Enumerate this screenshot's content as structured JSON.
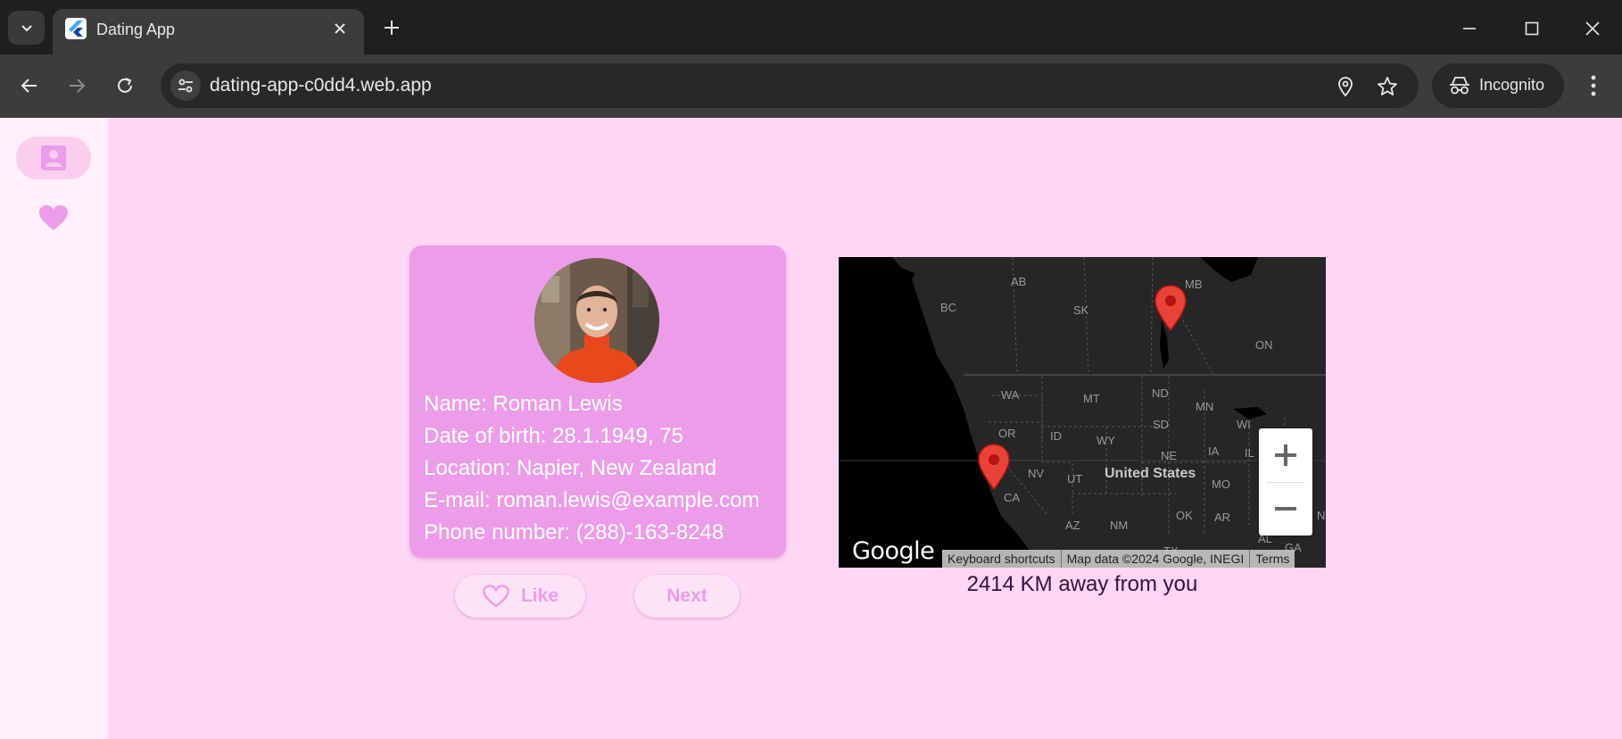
{
  "browser": {
    "tab_title": "Dating App",
    "url": "dating-app-c0dd4.web.app",
    "incognito_label": "Incognito"
  },
  "nav_rail": {
    "items": [
      {
        "name": "profile",
        "icon": "person-card-icon",
        "selected": true
      },
      {
        "name": "favorites",
        "icon": "heart-icon",
        "selected": false
      }
    ]
  },
  "profile": {
    "name": "Name: Roman Lewis",
    "dob": "Date of birth: 28.1.1949, 75",
    "location": "Location: Napier, New Zealand",
    "email": "E-mail: roman.lewis@example.com",
    "phone": "Phone number: (288)-163-8248"
  },
  "actions": {
    "like_label": "Like",
    "next_label": "Next"
  },
  "map": {
    "region_labels": [
      "AB",
      "MB",
      "BC",
      "SK",
      "ON",
      "WA",
      "MT",
      "ND",
      "MN",
      "SD",
      "WI",
      "OR",
      "ID",
      "WY",
      "NE",
      "IA",
      "NV",
      "UT",
      "MO",
      "CA",
      "OK",
      "AR",
      "AZ",
      "NM",
      "AL",
      "GA",
      "TX",
      "IL",
      "N"
    ],
    "country_label": "United States",
    "logo": "Google",
    "attribution": [
      "Keyboard shortcuts",
      "Map data ©2024 Google, INEGI",
      "Terms"
    ],
    "zoom_in": "+",
    "zoom_out": "−"
  },
  "distance_text": "2414 KM away from you",
  "colors": {
    "page_bg": "#ffd6f4",
    "card_bg": "#ec9ce9",
    "accent": "#ec9ce9",
    "pin": "#ea4335"
  }
}
